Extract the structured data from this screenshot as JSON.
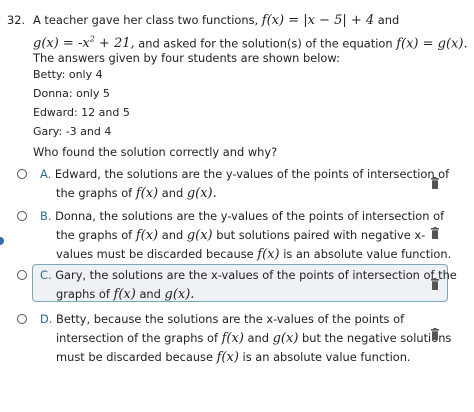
{
  "question": {
    "number": "32.",
    "line1_text": "A teacher gave her class two functions,",
    "f_def": "f(x) = |x − 5| + 4",
    "and1": "and",
    "g_def_lhs": "g(x) = -x",
    "g_exp": "2",
    "g_def_rhs": "+ 21,",
    "line2_text": "and asked for the solution(s) of the equation",
    "equation": "f(x) = g(x).",
    "line3": "The answers given by four students are shown below:"
  },
  "students": [
    {
      "text": "Betty: only 4"
    },
    {
      "text": "Donna: only 5"
    },
    {
      "text": "Edward: 12 and 5"
    },
    {
      "text": "Gary: -3 and 4"
    }
  ],
  "prompt": "Who found the solution correctly and why?",
  "options": {
    "A": {
      "letter": "A.",
      "l1": "Edward, the solutions are the y-values of the points of intersection of",
      "l2a": "the graphs of",
      "l2f": "f(x)",
      "l2and": "and",
      "l2g": "g(x)."
    },
    "B": {
      "letter": "B.",
      "l1": "Donna, the solutions are the y-values of the points of intersection of",
      "l2a": "the graphs of",
      "l2f": "f(x)",
      "l2and": "and",
      "l2g": "g(x)",
      "l2b": "but solutions paired with negative x-",
      "l3a": "values must be discarded because",
      "l3f": "f(x)",
      "l3b": "is an absolute value function."
    },
    "C": {
      "letter": "C.",
      "l1": "Gary, the solutions are the x-values of the points of intersection of the",
      "l2a": "graphs of",
      "l2f": "f(x)",
      "l2and": "and",
      "l2g": "g(x)."
    },
    "D": {
      "letter": "D.",
      "l1": "Betty, because the solutions are the x-values of the points of",
      "l2a": "intersection of the graphs of",
      "l2f": "f(x)",
      "l2and": "and",
      "l2g": "g(x)",
      "l2b": "but the negative solutions",
      "l3a": "must be discarded because",
      "l3f": "f(x)",
      "l3b": "is an absolute value function."
    }
  },
  "icons": {
    "radio": "radio-button-icon",
    "trash": "trash-icon"
  },
  "colors": {
    "letter": "#2b6a8f",
    "selected_border": "#7fa7bb",
    "selected_bg": "#eef2f4"
  }
}
